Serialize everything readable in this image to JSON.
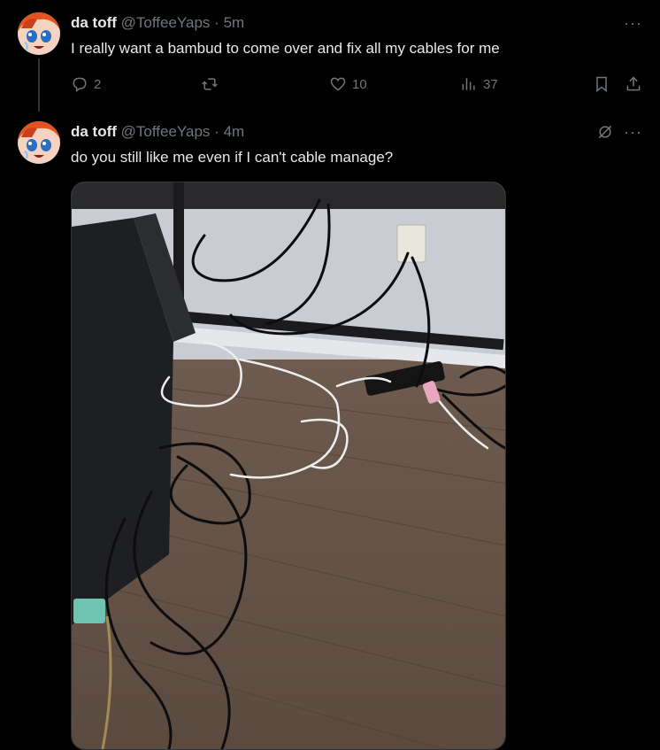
{
  "tweets": [
    {
      "name": "da toff",
      "handle": "@ToffeeYaps",
      "time": "5m",
      "text": "I really want a bambud to come over and fix all my cables for me",
      "stats": {
        "replies": "2",
        "likes": "10",
        "views": "37"
      }
    },
    {
      "name": "da toff",
      "handle": "@ToffeeYaps",
      "time": "4m",
      "text": "do you still like me even if I can't cable manage?"
    }
  ],
  "separator": "·",
  "more_label": "···",
  "icons": {
    "reply": "reply-icon",
    "retweet": "retweet-icon",
    "like": "heart-icon",
    "views": "views-icon",
    "bookmark": "bookmark-icon",
    "share": "share-icon",
    "grok": "grok-icon"
  },
  "colors": {
    "background": "#000000",
    "text": "#e7e9ea",
    "muted": "#71767b"
  }
}
